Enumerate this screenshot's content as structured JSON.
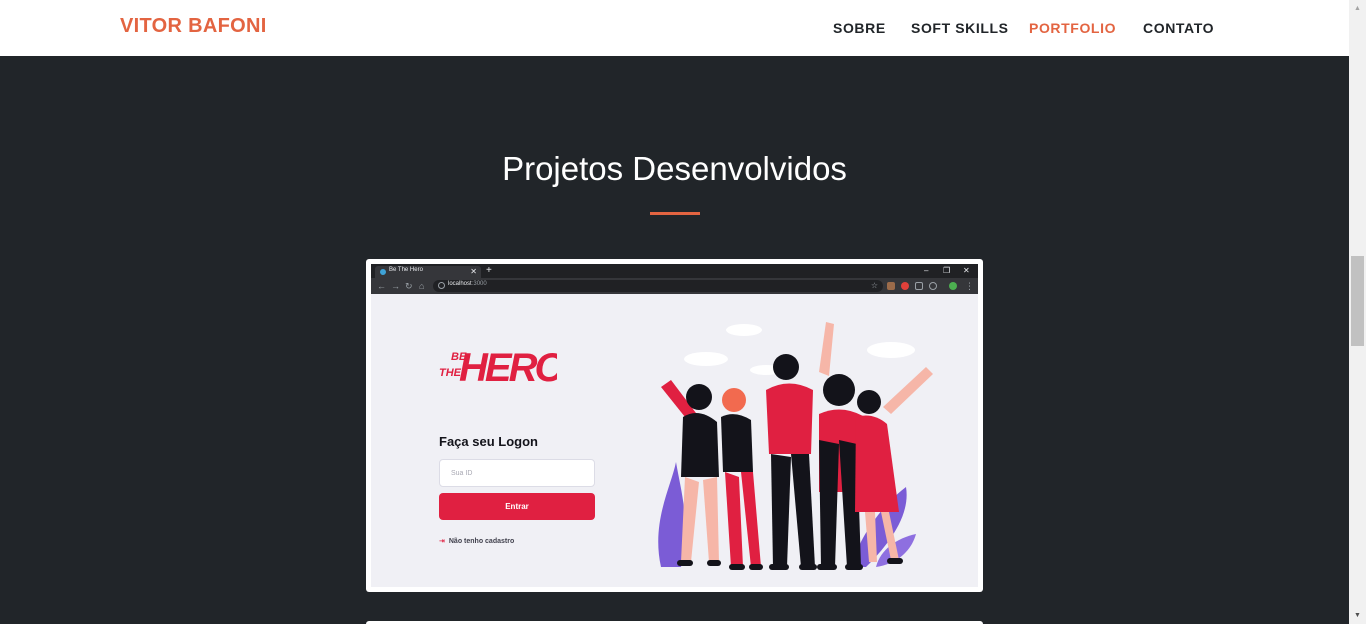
{
  "navbar": {
    "brand": "VITOR BAFONI",
    "links": [
      {
        "label": "SOBRE",
        "active": false
      },
      {
        "label": "SOFT SKILLS",
        "active": false
      },
      {
        "label": "PORTFOLIO",
        "active": true
      },
      {
        "label": "CONTATO",
        "active": false
      }
    ]
  },
  "section": {
    "title": "Projetos Desenvolvidos"
  },
  "project": {
    "browser": {
      "tab_title": "Be The Hero",
      "new_tab": "+",
      "url_host": "localhost",
      "url_port": ":3000"
    },
    "app": {
      "logo_small": [
        "BE",
        "THE"
      ],
      "logo_big": "HERO",
      "login_title": "Faça seu Logon",
      "id_placeholder": "Sua ID",
      "enter_button": "Entrar",
      "register_link": "Não tenho cadastro"
    }
  },
  "colors": {
    "accent": "#e36441",
    "background": "#212529",
    "app_red": "#e02041"
  },
  "icons": [
    "chevron-up-icon",
    "chevron-down-icon",
    "login-arrow-icon",
    "star-icon",
    "back-icon",
    "forward-icon",
    "reload-icon",
    "home-icon"
  ]
}
